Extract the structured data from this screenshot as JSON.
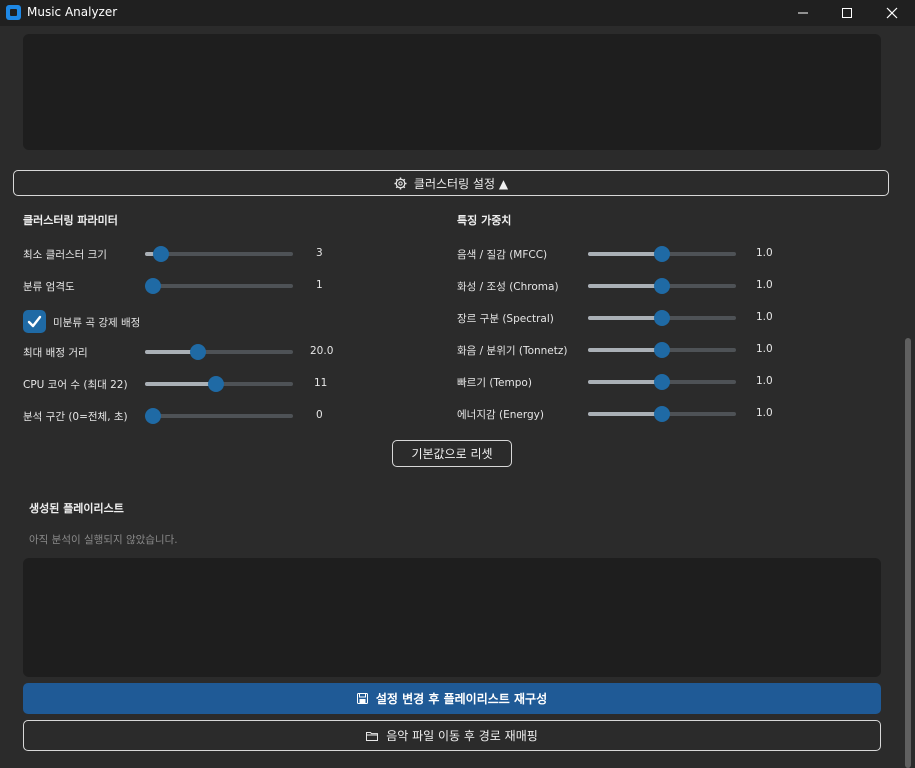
{
  "window": {
    "title": "Music Analyzer",
    "accent_color": "#1f6aa5"
  },
  "clustering_toggle": {
    "label": "클러스터링 설정 ▲",
    "icon": "gear-icon",
    "expanded": true
  },
  "params": {
    "title": "클러스터링 파라미터",
    "rows": [
      {
        "label": "최소 클러스터 크기",
        "value": "3",
        "level": 0.06
      },
      {
        "label": "분류 엄격도",
        "value": "1",
        "level": 0.0
      },
      {
        "label": "최대 배정 거리",
        "value": "20.0",
        "level": 0.34
      },
      {
        "label": "CPU 코어 수 (최대 22)",
        "value": "11",
        "level": 0.48
      },
      {
        "label": "분석 구간 (0=전체, 초)",
        "value": "0",
        "level": 0.0
      }
    ],
    "checkbox": {
      "label": "미분류 곡 강제 배정",
      "checked": true
    }
  },
  "weights": {
    "title": "특징 가중치",
    "rows": [
      {
        "label": "음색 / 질감 (MFCC)",
        "value": "1.0",
        "level": 0.5
      },
      {
        "label": "화성 / 조성 (Chroma)",
        "value": "1.0",
        "level": 0.5
      },
      {
        "label": "장르 구분 (Spectral)",
        "value": "1.0",
        "level": 0.5
      },
      {
        "label": "화음 / 분위기 (Tonnetz)",
        "value": "1.0",
        "level": 0.5
      },
      {
        "label": "빠르기 (Tempo)",
        "value": "1.0",
        "level": 0.5
      },
      {
        "label": "에너지감 (Energy)",
        "value": "1.0",
        "level": 0.5
      }
    ]
  },
  "reset_button": {
    "label": "기본값으로 리셋"
  },
  "playlist": {
    "title": "생성된 플레이리스트",
    "status": "아직 분석이 실행되지 않았습니다."
  },
  "rebuild_button": {
    "label": "설정 변경 후 플레이리스트 재구성",
    "icon": "save-icon"
  },
  "remap_button": {
    "label": "음악 파일 이동 후 경로 재매핑",
    "icon": "folder-icon"
  }
}
